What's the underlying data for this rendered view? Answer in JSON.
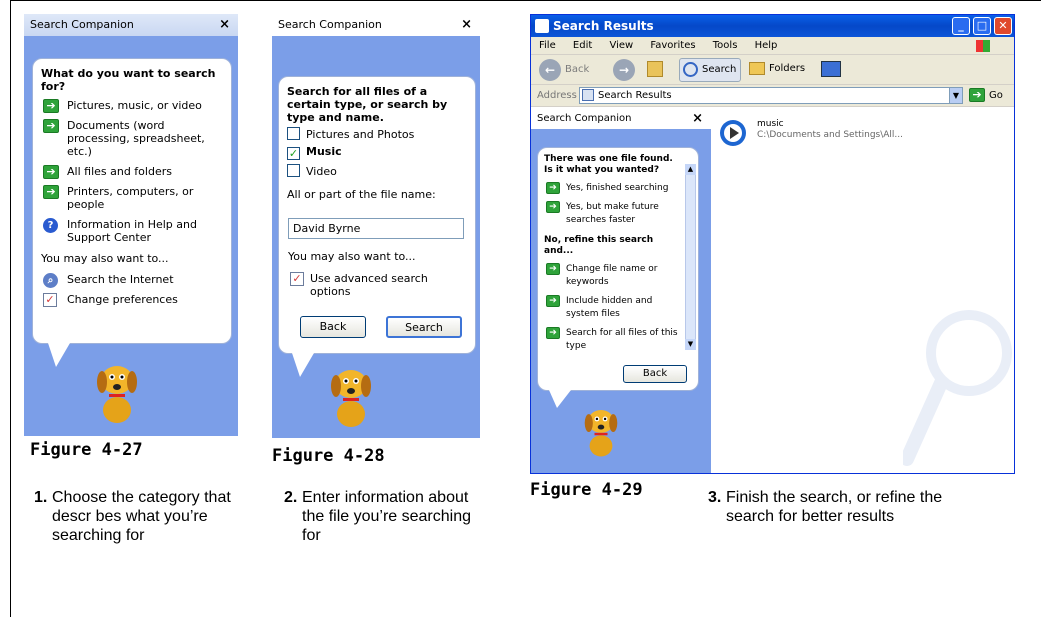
{
  "panel1": {
    "header": "Search Companion",
    "close": "×",
    "question": "What do you want to search for?",
    "options": [
      "Pictures, music, or video",
      "Documents (word processing, spreadsheet, etc.)",
      "All files and folders",
      "Printers, computers, or people",
      "Information in Help and Support Center"
    ],
    "also": "You may also want to...",
    "extra": [
      "Search the Internet",
      "Change preferences"
    ]
  },
  "panel2": {
    "header": "Search Companion",
    "close": "×",
    "question": "Search for all files of a certain type, or search by type and name.",
    "types": [
      "Pictures and Photos",
      "Music",
      "Video"
    ],
    "filename_label": "All or part of the file name:",
    "filename_value": "David Byrne",
    "also": "You may also want to...",
    "advanced": "Use advanced search options",
    "back": "Back",
    "search": "Search"
  },
  "window": {
    "title": "Search Results",
    "menu": [
      "File",
      "Edit",
      "View",
      "Favorites",
      "Tools",
      "Help"
    ],
    "back": "Back",
    "search": "Search",
    "folders": "Folders",
    "address_label": "Address",
    "address_value": "Search Results",
    "go": "Go",
    "companion_header": "Search Companion",
    "close": "×",
    "found": "There was one file found. Is it what you wanted?",
    "yes_options": [
      "Yes, finished searching",
      "Yes, but make future searches faster"
    ],
    "refine": "No, refine this search and...",
    "refine_options": [
      "Change file name or keywords",
      "Include hidden and system files",
      "Search for all files of this type"
    ],
    "back_btn": "Back",
    "result_name": "music",
    "result_path": "C:\\Documents and Settings\\All..."
  },
  "figures": [
    "Figure 4-27",
    "Figure 4-28",
    "Figure 4-29"
  ],
  "steps": [
    {
      "num": "1.",
      "text": "Choose the category that descr bes what you’re searching for"
    },
    {
      "num": "2.",
      "text": "Enter information about the file you’re searching for"
    },
    {
      "num": "3.",
      "text": "Finish the search, or refine the search for better results"
    }
  ]
}
